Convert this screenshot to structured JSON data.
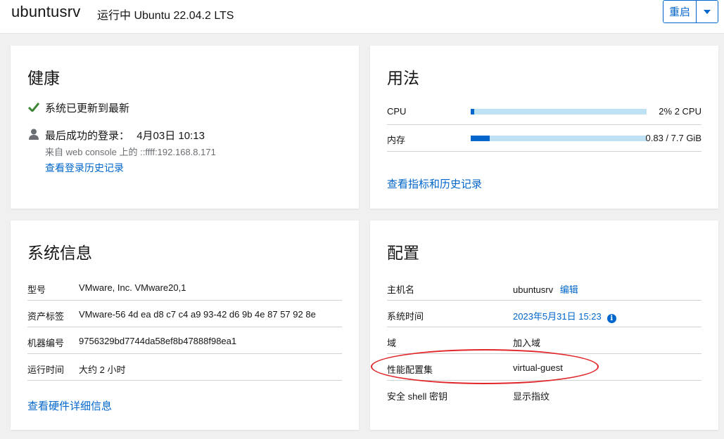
{
  "header": {
    "hostname": "ubuntusrv",
    "status": "运行中 Ubuntu 22.04.2 LTS",
    "restart_label": "重启"
  },
  "health": {
    "title": "健康",
    "updates_status": "系统已更新到最新",
    "last_login_label": "最后成功的登录：",
    "last_login_time": "4月03日 10:13",
    "last_login_from": "来自 web console 上的 ::ffff:192.168.8.171",
    "login_history_link": "查看登录历史记录"
  },
  "usage": {
    "title": "用法",
    "rows": [
      {
        "label": "CPU",
        "value": "2% 2 CPU",
        "fraction": 0.02
      },
      {
        "label": "内存",
        "value": "0.83 / 7.7 GiB",
        "fraction": 0.108
      }
    ],
    "metrics_link": "查看指标和历史记录"
  },
  "sysinfo": {
    "title": "系统信息",
    "rows": [
      {
        "key": "型号",
        "value": "VMware, Inc. VMware20,1"
      },
      {
        "key": "资产标签",
        "value": "VMware-56 4d ea d8 c7 c4 a9 93-42 d6 9b 4e 87 57 92 8e"
      },
      {
        "key": "机器编号",
        "value": "9756329bd7744da58ef8b47888f98ea1"
      },
      {
        "key": "运行时间",
        "value": "大约 2 小时"
      }
    ],
    "hardware_link": "查看硬件详细信息"
  },
  "config": {
    "title": "配置",
    "hostname_key": "主机名",
    "hostname_value": "ubuntusrv",
    "hostname_edit": "编辑",
    "time_key": "系统时间",
    "time_value": "2023年5月31日 15:23",
    "domain_key": "域",
    "domain_value": "加入域",
    "profile_key": "性能配置集",
    "profile_value": "virtual-guest",
    "ssh_key": "安全 shell 密钥",
    "ssh_value": "显示指纹"
  },
  "colors": {
    "link": "#0066cc",
    "check": "#3e8635",
    "annotation": "#e0262a",
    "bar_track": "#bee1f4"
  },
  "icons": [
    "check-icon",
    "user-icon",
    "caret-down-icon",
    "info-circle-icon"
  ]
}
